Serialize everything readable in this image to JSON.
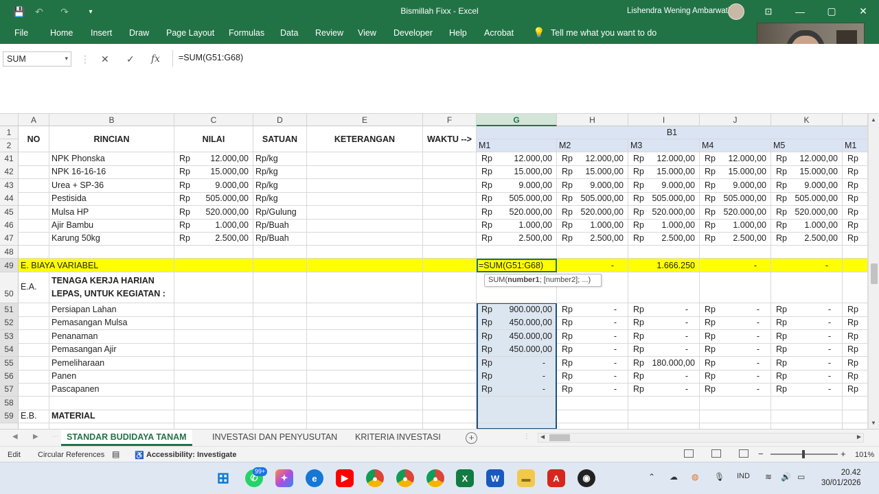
{
  "window": {
    "title": "Bismillah Fixx  -  Excel",
    "user": "Lishendra Wening Ambarwati",
    "minimize": "—",
    "restore": "▢",
    "close": "✕"
  },
  "quick_access": {
    "save": "💾",
    "undo": "↶",
    "redo": "↷",
    "customize": "▾"
  },
  "ribbon": {
    "tabs": [
      "File",
      "Home",
      "Insert",
      "Draw",
      "Page Layout",
      "Formulas",
      "Data",
      "Review",
      "View",
      "Developer",
      "Help",
      "Acrobat"
    ],
    "tell_me": "Tell me what you want to do"
  },
  "formula_bar": {
    "name_box": "SUM",
    "cancel": "✕",
    "enter": "✓",
    "fx": "fx",
    "formula": "=SUM(G51:G68)"
  },
  "columns": [
    "A",
    "B",
    "C",
    "D",
    "E",
    "F",
    "G",
    "H",
    "I",
    "J",
    "K"
  ],
  "header": {
    "no": "NO",
    "rincian": "RINCIAN",
    "nilai": "NILAI",
    "satuan": "SATUAN",
    "keterangan": "KETERANGAN",
    "waktu": "WAKTU -->",
    "b1": "B1",
    "months": [
      "M1",
      "M2",
      "M3",
      "M4",
      "M5",
      "M1"
    ]
  },
  "rows": [
    {
      "num": "41",
      "b": "NPK Phonska",
      "c": "12.000,00",
      "d": "Rp/kg",
      "vals": [
        "12.000,00",
        "12.000,00",
        "12.000,00",
        "12.000,00",
        "12.000,00"
      ]
    },
    {
      "num": "42",
      "b": "NPK 16-16-16",
      "c": "15.000,00",
      "d": "Rp/kg",
      "vals": [
        "15.000,00",
        "15.000,00",
        "15.000,00",
        "15.000,00",
        "15.000,00"
      ]
    },
    {
      "num": "43",
      "b": "Urea + SP-36",
      "c": "9.000,00",
      "d": "Rp/kg",
      "vals": [
        "9.000,00",
        "9.000,00",
        "9.000,00",
        "9.000,00",
        "9.000,00"
      ]
    },
    {
      "num": "44",
      "b": "Pestisida",
      "c": "505.000,00",
      "d": "Rp/kg",
      "vals": [
        "505.000,00",
        "505.000,00",
        "505.000,00",
        "505.000,00",
        "505.000,00"
      ]
    },
    {
      "num": "45",
      "b": "Mulsa HP",
      "c": "520.000,00",
      "d": "Rp/Gulung",
      "vals": [
        "520.000,00",
        "520.000,00",
        "520.000,00",
        "520.000,00",
        "520.000,00"
      ]
    },
    {
      "num": "46",
      "b": "Ajir Bambu",
      "c": "1.000,00",
      "d": "Rp/Buah",
      "vals": [
        "1.000,00",
        "1.000,00",
        "1.000,00",
        "1.000,00",
        "1.000,00"
      ]
    },
    {
      "num": "47",
      "b": "Karung 50kg",
      "c": "2.500,00",
      "d": "Rp/Buah",
      "vals": [
        "2.500,00",
        "2.500,00",
        "2.500,00",
        "2.500,00",
        "2.500,00"
      ]
    }
  ],
  "row48": "48",
  "row49": {
    "num": "49",
    "a": "E. BIAYA VARIABEL",
    "g": "=SUM(G51:G68)",
    "h": "-",
    "i": "1.666.250",
    "j": "-",
    "k": "-"
  },
  "row50": {
    "num": "50",
    "a": "E.A.",
    "b1": "TENAGA KERJA HARIAN",
    "b2": "LEPAS, UNTUK KEGIATAN :"
  },
  "tooltip": {
    "fn": "SUM(",
    "arg1": "number1",
    "rest": "; [number2]; ...)"
  },
  "labor_rows": [
    {
      "num": "51",
      "b": "Persiapan Lahan",
      "g": "900.000,00",
      "h": "-",
      "i": "-",
      "j": "-",
      "k": "-"
    },
    {
      "num": "52",
      "b": "Pemasangan Mulsa",
      "g": "450.000,00",
      "h": "-",
      "i": "-",
      "j": "-",
      "k": "-"
    },
    {
      "num": "53",
      "b": "Penanaman",
      "g": "450.000,00",
      "h": "-",
      "i": "-",
      "j": "-",
      "k": "-"
    },
    {
      "num": "54",
      "b": "Pemasangan Ajir",
      "g": "450.000,00",
      "h": "-",
      "i": "-",
      "j": "-",
      "k": "-"
    },
    {
      "num": "55",
      "b": "Pemeliharaan",
      "g": "-",
      "h": "-",
      "i": "180.000,00",
      "j": "-",
      "k": "-"
    },
    {
      "num": "56",
      "b": "Panen",
      "g": "-",
      "h": "-",
      "i": "-",
      "j": "-",
      "k": "-"
    },
    {
      "num": "57",
      "b": "Pascapanen",
      "g": "-",
      "h": "-",
      "i": "-",
      "j": "-",
      "k": "-"
    }
  ],
  "row58": "58",
  "row59": {
    "num": "59",
    "a": "E.B.",
    "b": "MATERIAL"
  },
  "currency": "Rp",
  "sheets": [
    "STANDAR BUDIDAYA TANAM",
    "INVESTASI DAN PENYUSUTAN",
    "KRITERIA INVESTASI"
  ],
  "status": {
    "mode": "Edit",
    "circular": "Circular References",
    "accessibility": "Accessibility: Investigate",
    "zoom": "101%"
  },
  "taskbar": {
    "whatsapp_badge": "99+",
    "lang": "IND",
    "time": "20.42",
    "date": "30/01/2026"
  }
}
